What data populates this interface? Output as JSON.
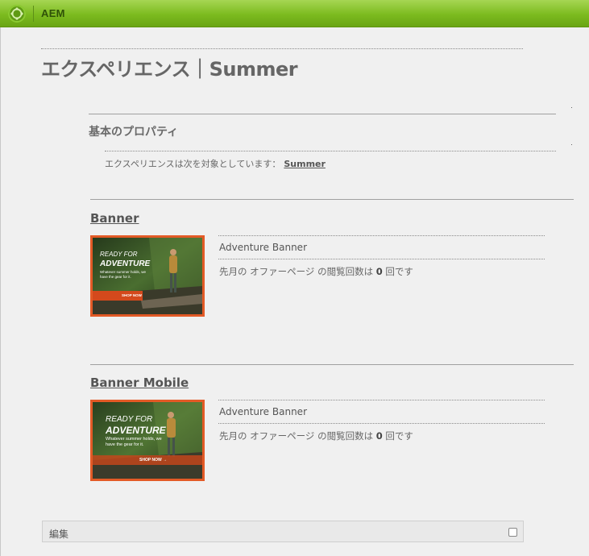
{
  "app": {
    "name": "AEM",
    "accent": "#7cbb1f",
    "logo_icon": "aem-logo-icon"
  },
  "page": {
    "title": "エクスペリエンス｜Summer"
  },
  "properties": {
    "section_title": "基本のプロパティ",
    "target_text": "エクスペリエンスは次を対象としています：",
    "target_value": "Summer"
  },
  "offers": [
    {
      "title": "Banner",
      "name": "Adventure Banner",
      "stat_prefix": "先月の オファーページ の閲覧回数は",
      "views": "0",
      "stat_suffix": "回です",
      "image": {
        "line1": "READY FOR",
        "line2": "ADVENTURE",
        "line3": "Whatever summer holds, we",
        "line4": "have the gear for it.",
        "button": "SHOP NOW"
      }
    },
    {
      "title": "Banner Mobile",
      "name": "Adventure Banner",
      "stat_prefix": "先月の オファーページ の閲覧回数は",
      "views": "0",
      "stat_suffix": "回です",
      "image": {
        "line1": "READY FOR",
        "line2": "ADVENTURE",
        "line3": "Whatever summer holds, we",
        "line4": "have the gear for it.",
        "button": "SHOP NOW →"
      }
    }
  ],
  "edit_bar": {
    "label": "編集"
  },
  "colors": {
    "thumb_border": "#e35a26",
    "foliage": "#3f5f2a"
  }
}
